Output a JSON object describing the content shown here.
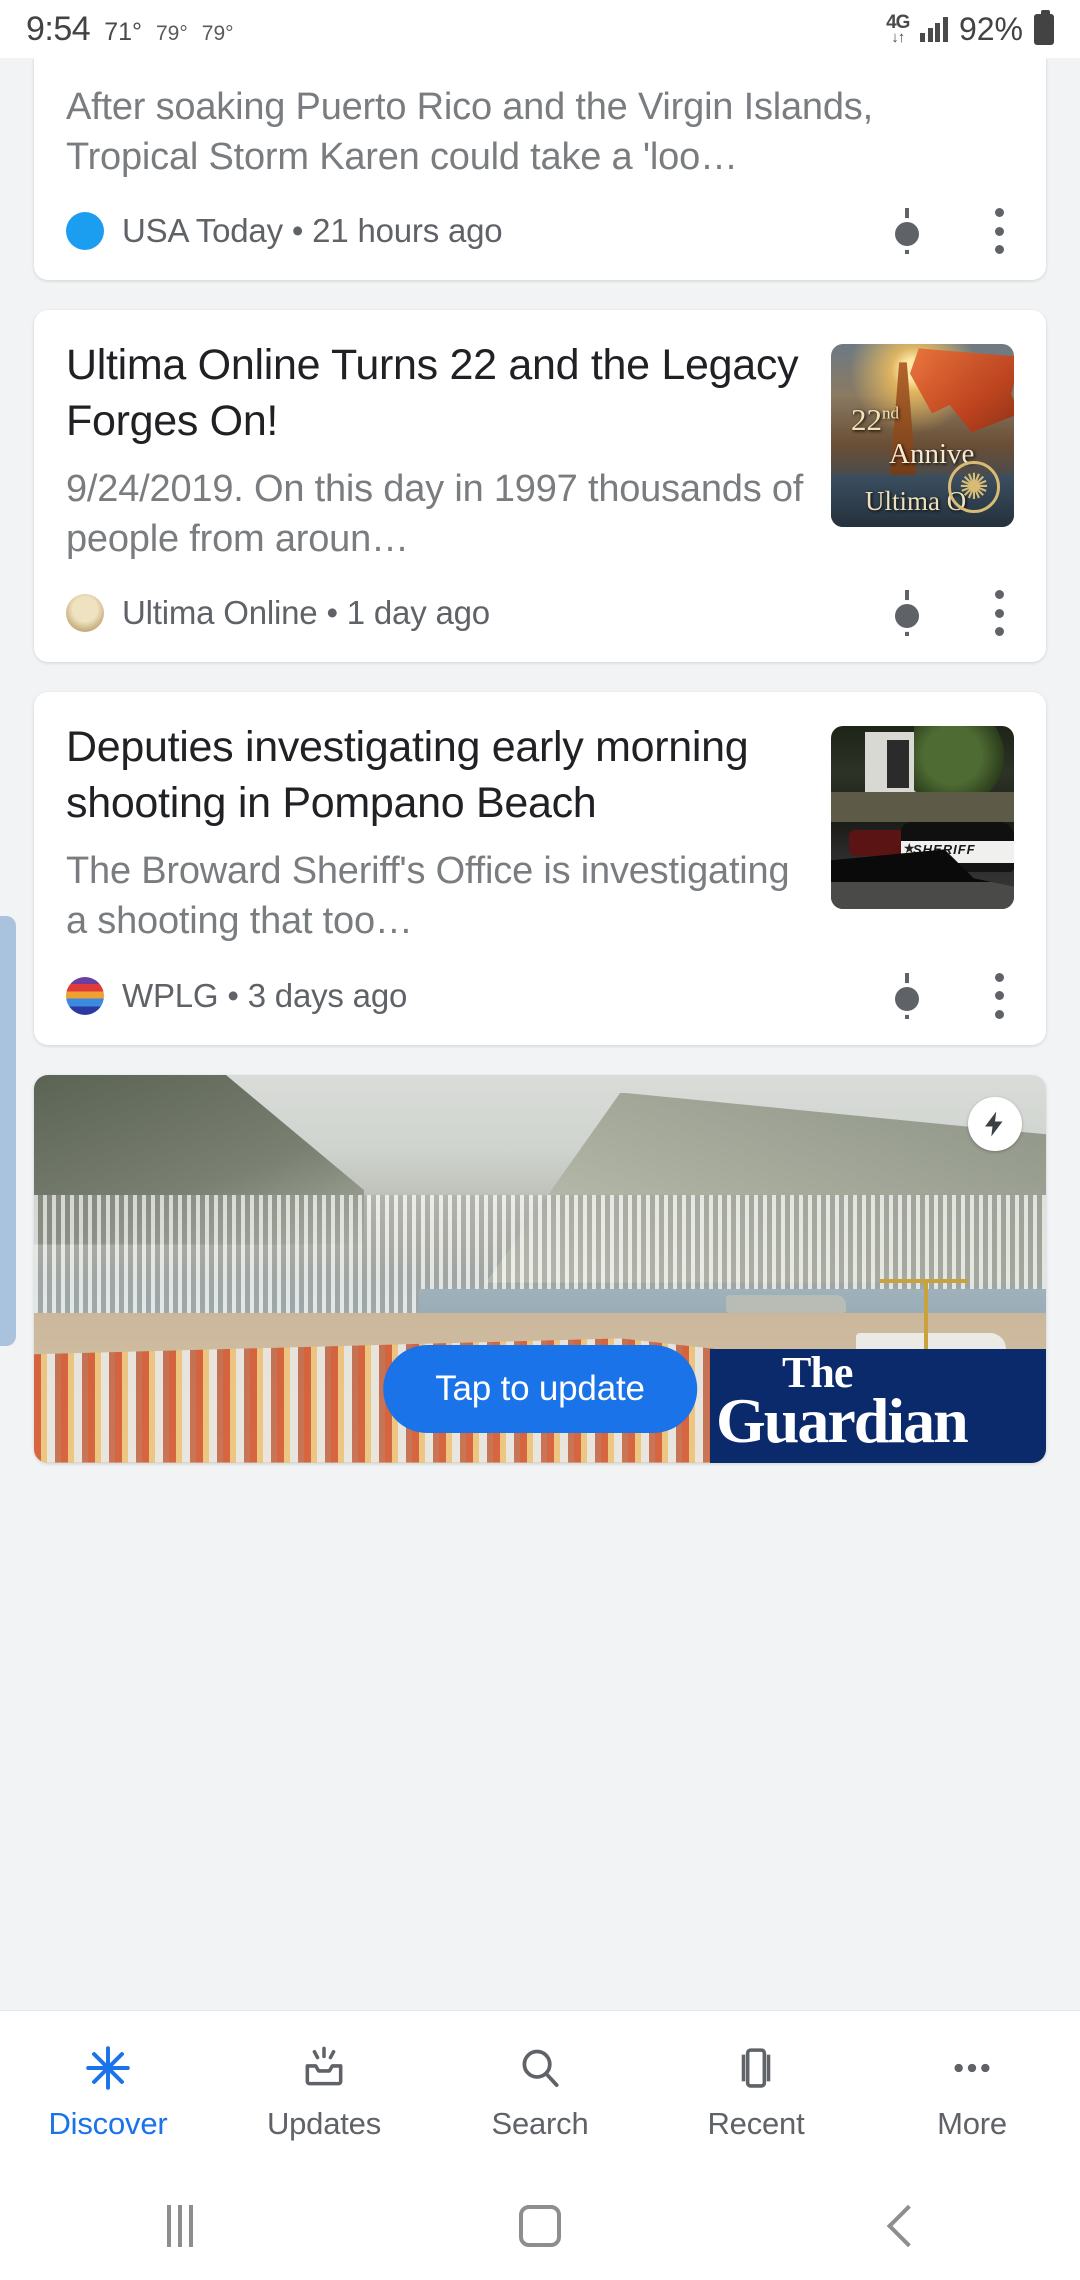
{
  "status_bar": {
    "time": "9:54",
    "temp_current": "71°",
    "temp_high": "79°",
    "temp_low": "79°",
    "network_type": "4G",
    "network_arrows": "↓↑",
    "battery_percent": "92%"
  },
  "feed": {
    "cards": [
      {
        "headline": "",
        "snippet": "After soaking Puerto Rico and the Virgin Islands, Tropical Storm Karen could take a 'loo…",
        "publisher": "USA Today",
        "time_ago": "21 hours ago",
        "separator": "•",
        "publisher_icon": "usa-today-icon",
        "share_icon": "share-icon",
        "menu_icon": "overflow-menu-icon",
        "has_thumb": false
      },
      {
        "headline": "Ultima Online Turns 22 and the Legacy Forges On!",
        "snippet": "9/24/2019. On this day in 1997 thousands of people from aroun…",
        "publisher": "Ultima Online",
        "time_ago": "1 day ago",
        "separator": "•",
        "publisher_icon": "ultima-online-icon",
        "share_icon": "share-icon",
        "menu_icon": "overflow-menu-icon",
        "has_thumb": true,
        "thumb_alt": "Ultima Online 22nd Anniversary artwork",
        "thumb_text_line1": "22",
        "thumb_text_sup": "nd",
        "thumb_text_line2": "Annive",
        "thumb_text_line3": "Ultima O"
      },
      {
        "headline": "Deputies investigating early morning shooting in Pompano Beach",
        "snippet": "The Broward Sheriff's Office is investigating a shooting that too…",
        "publisher": "WPLG",
        "time_ago": "3 days ago",
        "separator": "•",
        "publisher_icon": "wplg-icon",
        "share_icon": "share-icon",
        "menu_icon": "overflow-menu-icon",
        "has_thumb": true,
        "thumb_alt": "Sheriff patrol car at night outside an apartment building",
        "thumb_car_label": "SHERIFF"
      }
    ],
    "amp_card": {
      "image_alt": "Aerial view of a port city with shipping containers and mountains",
      "amp_badge_icon": "amp-lightning-bolt-icon",
      "update_button_label": "Tap to update",
      "brand_line1": "The",
      "brand_line2": "Guardian",
      "brand_bg_color": "#0b2a6b",
      "update_button_color": "#1a73e8"
    }
  },
  "bottom_nav": {
    "active_color": "#1a73e8",
    "items": [
      {
        "label": "Discover",
        "icon": "discover-asterisk-icon",
        "active": true
      },
      {
        "label": "Updates",
        "icon": "updates-inbox-icon",
        "active": false
      },
      {
        "label": "Search",
        "icon": "search-magnifier-icon",
        "active": false
      },
      {
        "label": "Recent",
        "icon": "recent-tabs-icon",
        "active": false
      },
      {
        "label": "More",
        "icon": "more-dots-icon",
        "active": false
      }
    ]
  },
  "system_nav": {
    "recents_icon": "recents-icon",
    "home_icon": "home-icon",
    "back_icon": "back-icon"
  }
}
